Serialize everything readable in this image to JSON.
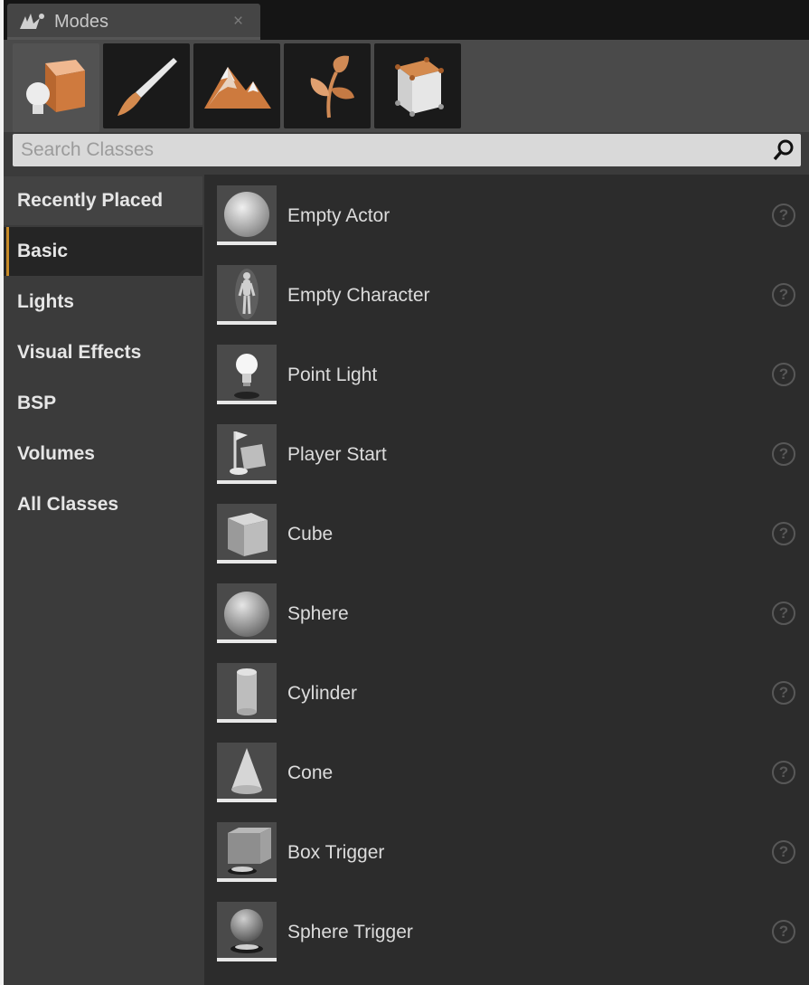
{
  "tab": {
    "title": "Modes",
    "close": "×"
  },
  "modes": [
    {
      "name": "place-mode",
      "active": true
    },
    {
      "name": "paint-mode",
      "active": false
    },
    {
      "name": "landscape-mode",
      "active": false
    },
    {
      "name": "foliage-mode",
      "active": false
    },
    {
      "name": "geometry-mode",
      "active": false
    }
  ],
  "search": {
    "placeholder": "Search Classes"
  },
  "categories": [
    {
      "label": "Recently Placed"
    },
    {
      "label": "Basic"
    },
    {
      "label": "Lights"
    },
    {
      "label": "Visual Effects"
    },
    {
      "label": "BSP"
    },
    {
      "label": "Volumes"
    },
    {
      "label": "All Classes"
    }
  ],
  "active_category": "Basic",
  "items": [
    {
      "label": "Empty Actor",
      "icon": "empty-actor-icon"
    },
    {
      "label": "Empty Character",
      "icon": "empty-character-icon"
    },
    {
      "label": "Point Light",
      "icon": "point-light-icon"
    },
    {
      "label": "Player Start",
      "icon": "player-start-icon"
    },
    {
      "label": "Cube",
      "icon": "cube-icon"
    },
    {
      "label": "Sphere",
      "icon": "sphere-icon"
    },
    {
      "label": "Cylinder",
      "icon": "cylinder-icon"
    },
    {
      "label": "Cone",
      "icon": "cone-icon"
    },
    {
      "label": "Box Trigger",
      "icon": "box-trigger-icon"
    },
    {
      "label": "Sphere Trigger",
      "icon": "sphere-trigger-icon"
    }
  ],
  "help_glyph": "?",
  "colors": {
    "accent": "#c78a27",
    "panel": "#2c2c2c",
    "sidebar": "#3b3b3b"
  }
}
